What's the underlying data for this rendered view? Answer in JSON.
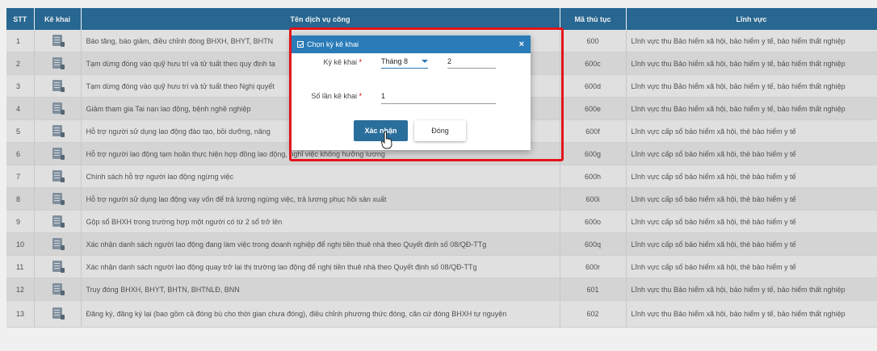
{
  "table": {
    "headers": {
      "stt": "STT",
      "ke_khai": "Kê khai",
      "ten": "Tên dịch vụ công",
      "ma": "Mã thủ tục",
      "linh_vuc": "Lĩnh vực"
    },
    "rows": [
      {
        "stt": "1",
        "ten": "Báo tăng, báo giảm, điều chỉnh đóng BHXH, BHYT, BHTN",
        "ma": "600",
        "linh_vuc": "Lĩnh vực thu Bảo hiểm xã hội, bảo hiểm y tế, bảo hiểm thất nghiệp"
      },
      {
        "stt": "2",
        "ten": "Tạm dừng đóng vào quỹ hưu trí và tử tuất theo quy định tạ",
        "ma": "600c",
        "linh_vuc": "Lĩnh vực thu Bảo hiểm xã hội, bảo hiểm y tế, bảo hiểm thất nghiệp"
      },
      {
        "stt": "3",
        "ten": "Tạm dừng đóng vào quỹ hưu trí và tử tuất theo Nghị quyết",
        "ma": "600d",
        "linh_vuc": "Lĩnh vực thu Bảo hiểm xã hội, bảo hiểm y tế, bảo hiểm thất nghiệp"
      },
      {
        "stt": "4",
        "ten": "Giảm tham gia Tai nạn lao động, bệnh nghề nghiệp",
        "ma": "600e",
        "linh_vuc": "Lĩnh vực thu Bảo hiểm xã hội, bảo hiểm y tế, bảo hiểm thất nghiệp"
      },
      {
        "stt": "5",
        "ten": "Hỗ trợ người sử dụng lao động đào tạo, bồi dưỡng, nâng",
        "ma": "600f",
        "linh_vuc": "Lĩnh vực cấp sổ bảo hiểm xã hội, thẻ bảo hiểm y tế"
      },
      {
        "stt": "6",
        "ten": "Hỗ trợ người lao động tạm hoãn thực hiện hợp đồng lao động, nghỉ việc không hưởng lương",
        "ma": "600g",
        "linh_vuc": "Lĩnh vực cấp sổ bảo hiểm xã hội, thẻ bảo hiểm y tế"
      },
      {
        "stt": "7",
        "ten": "Chính sách hỗ trợ người lao động ngừng việc",
        "ma": "600h",
        "linh_vuc": "Lĩnh vực cấp sổ bảo hiểm xã hội, thẻ bảo hiểm y tế"
      },
      {
        "stt": "8",
        "ten": "Hỗ trợ người sử dụng lao động vay vốn để trả lương ngừng việc, trả lương phục hồi sản xuất",
        "ma": "600i",
        "linh_vuc": "Lĩnh vực cấp sổ bảo hiểm xã hội, thẻ bảo hiểm y tế"
      },
      {
        "stt": "9",
        "ten": "Gộp sổ BHXH trong trường hợp một người có từ 2 sổ trở lên",
        "ma": "600o",
        "linh_vuc": "Lĩnh vực cấp sổ bảo hiểm xã hội, thẻ bảo hiểm y tế"
      },
      {
        "stt": "10",
        "ten": "Xác nhận danh sách người lao động đang làm việc trong doanh nghiệp để nghị tiền thuê nhà theo Quyết định số 08/QĐ-TTg",
        "ma": "600q",
        "linh_vuc": "Lĩnh vực cấp sổ bảo hiểm xã hội, thẻ bảo hiểm y tế"
      },
      {
        "stt": "11",
        "ten": "Xác nhận danh sách người lao động quay trở lại thị trường lao động để nghị tiền thuê nhà theo Quyết định số 08/QĐ-TTg",
        "ma": "600r",
        "linh_vuc": "Lĩnh vực cấp sổ bảo hiểm xã hội, thẻ bảo hiểm y tế"
      },
      {
        "stt": "12",
        "ten": "Truy đóng BHXH, BHYT, BHTN, BHTNLĐ, BNN",
        "ma": "601",
        "linh_vuc": "Lĩnh vực thu Bảo hiểm xã hội, bảo hiểm y tế, bảo hiểm thất nghiệp"
      },
      {
        "stt": "13",
        "ten": "Đăng ký, đăng ký lại (bao gồm cả đóng bù cho thời gian chưa đóng), điều chỉnh phương thức đóng, căn cứ đóng BHXH tự nguyện",
        "ma": "602",
        "linh_vuc": "Lĩnh vực thu Bảo hiểm xã hội, bảo hiểm y tế, bảo hiểm thất nghiệp"
      }
    ]
  },
  "modal": {
    "title": "Chọn kỳ kê khai",
    "close_symbol": "×",
    "ky_ke_khai_label": "Kỳ kê khai",
    "so_lan_label": "Số lần kê khai",
    "required_mark": "*",
    "month_value": "Tháng 8",
    "year_value": "2",
    "so_lan_value": "1",
    "confirm_label": "Xác nhận",
    "close_label": "Đóng"
  },
  "colors": {
    "header_bg": "#2a6e9b",
    "modal_header": "#2a7bb8",
    "highlight": "#e3141c"
  }
}
